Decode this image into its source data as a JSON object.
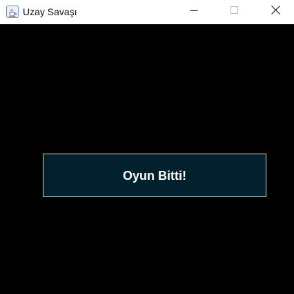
{
  "window": {
    "title": "Uzay Savaşı",
    "app_icon": "java-coffee-cup-icon",
    "controls": [
      "minimize-icon",
      "maximize-icon",
      "close-icon"
    ]
  },
  "game": {
    "message": "Oyun Bitti!"
  },
  "colors": {
    "background": "#000000",
    "panel_fill": "#03202f",
    "panel_border": "#d9d9d9",
    "message_text": "#ffffff"
  }
}
